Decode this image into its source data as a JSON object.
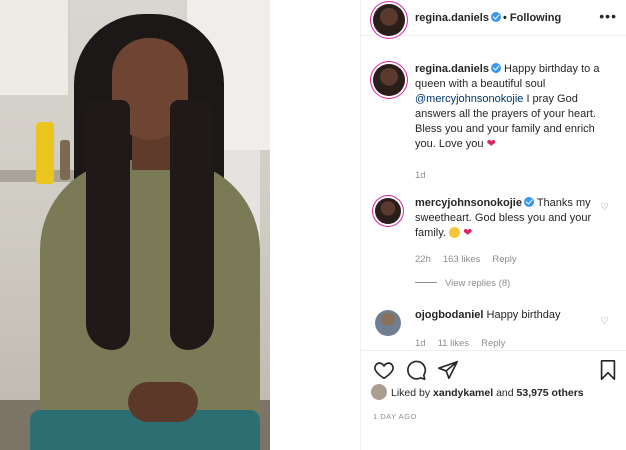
{
  "header": {
    "username": "regina.daniels",
    "follow_status": "• Following",
    "more": "•••"
  },
  "caption": {
    "username": "regina.daniels",
    "text_before": " Happy birthday to a queen with a beautiful soul ",
    "mention": "@mercyjohnsonokojie",
    "text_after": " I pray God answers all the prayers of your heart. Bless you and your family and enrich you. Love you ",
    "emoji": "❤",
    "time": "1d"
  },
  "comments": [
    {
      "username": "mercyjohnsonokojie",
      "text": " Thanks my sweetheart. God bless you and your family. ",
      "emoji_heart": "❤",
      "time": "22h",
      "likes": "163 likes",
      "reply": "Reply"
    },
    {
      "username": "ojogbodaniel",
      "text": " Happy birthday",
      "time": "1d",
      "likes": "11 likes",
      "reply": "Reply"
    }
  ],
  "view_replies": "View replies (8)",
  "likes": {
    "prefix": "Liked by ",
    "user": "xandykamel",
    "middle": " and ",
    "others": "53,975 others"
  },
  "posted": "1 DAY AGO",
  "icons": [
    "heart-icon",
    "comment-icon",
    "share-icon",
    "bookmark-icon",
    "verified-icon",
    "more-icon"
  ],
  "colors": {
    "verified": "#3897f0",
    "story_ring": "#d6249f",
    "heart": "#e0245e"
  }
}
